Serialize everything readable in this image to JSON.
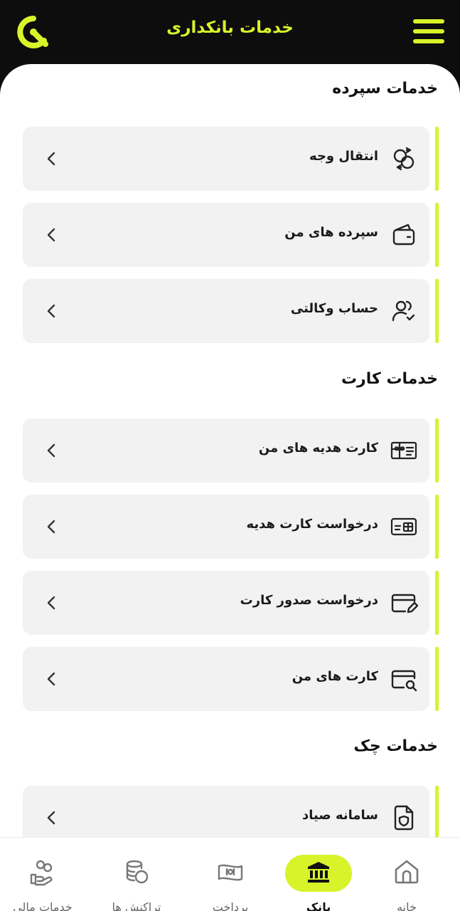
{
  "header": {
    "title": "خدمات بانکداری",
    "accent": "#d8f32a",
    "background": "#0d0d0d"
  },
  "sections": [
    {
      "title": "خدمات سپرده",
      "items": [
        {
          "label": "انتقال وجه",
          "icon": "transfer-icon"
        },
        {
          "label": "سپرده های من",
          "icon": "wallet-icon"
        },
        {
          "label": "حساب وکالتی",
          "icon": "users-check-icon"
        }
      ]
    },
    {
      "title": "خدمات کارت",
      "items": [
        {
          "label": "کارت هدیه های من",
          "icon": "gift-card-icon"
        },
        {
          "label": "درخواست کارت هدیه",
          "icon": "card-gift-icon"
        },
        {
          "label": "درخواست صدور کارت",
          "icon": "card-edit-icon"
        },
        {
          "label": "کارت های من",
          "icon": "card-search-icon"
        }
      ]
    },
    {
      "title": "خدمات چک",
      "items": [
        {
          "label": "سامانه صیاد",
          "icon": "document-shield-icon"
        }
      ]
    }
  ],
  "bottom_nav": [
    {
      "label": "خانه",
      "icon": "home-icon",
      "active": false
    },
    {
      "label": "بانک",
      "icon": "bank-icon",
      "active": true
    },
    {
      "label": "پرداخت",
      "icon": "money-icon",
      "active": false
    },
    {
      "label": "تراکنش ها",
      "icon": "coins-icon",
      "active": false
    },
    {
      "label": "خدمات مالی",
      "icon": "hand-coins-icon",
      "active": false
    }
  ]
}
